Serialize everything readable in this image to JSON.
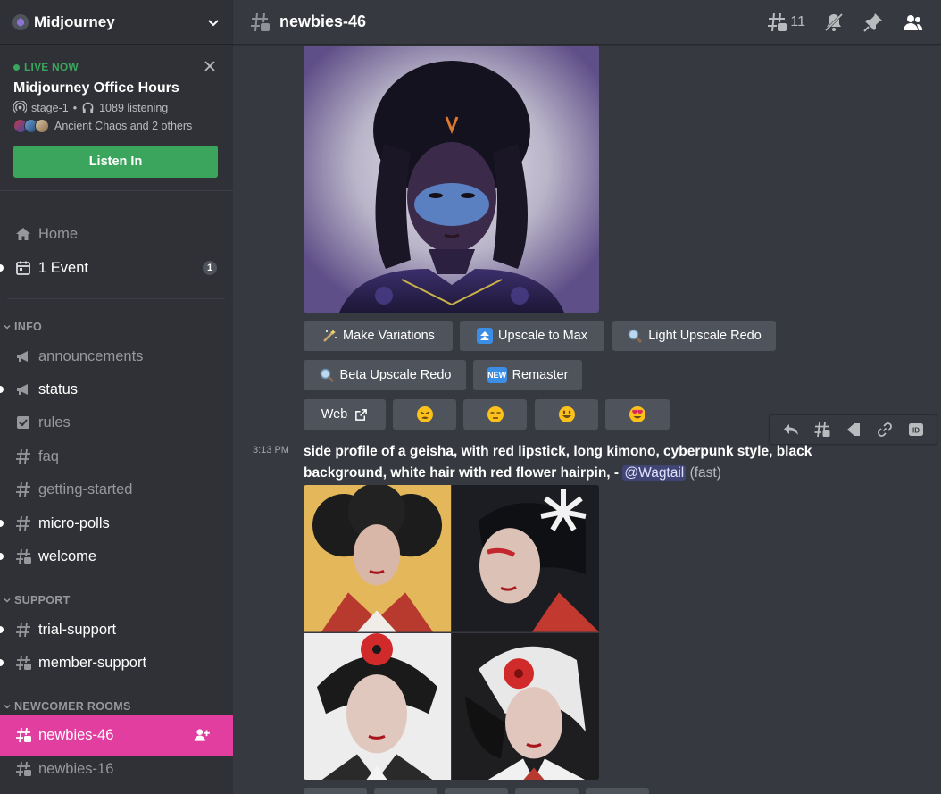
{
  "server": {
    "name": "Midjourney"
  },
  "live": {
    "badge": "LIVE NOW",
    "title": "Midjourney Office Hours",
    "stage": "stage-1",
    "listening": "1089 listening",
    "participants": "Ancient Chaos and 2 others",
    "listen_label": "Listen In"
  },
  "nav": {
    "home": "Home",
    "event_label": "1 Event",
    "event_count": "1"
  },
  "categories": {
    "info": "INFO",
    "support": "SUPPORT",
    "newcomer": "NEWCOMER ROOMS"
  },
  "channels": {
    "announcements": "announcements",
    "status": "status",
    "rules": "rules",
    "faq": "faq",
    "getting_started": "getting-started",
    "micro_polls": "micro-polls",
    "welcome": "welcome",
    "trial_support": "trial-support",
    "member_support": "member-support",
    "newbies_46": "newbies-46",
    "newbies_16": "newbies-16"
  },
  "header": {
    "channel": "newbies-46",
    "thread_count": "11"
  },
  "buttons": {
    "make_variations": "Make Variations",
    "upscale_max": "Upscale to Max",
    "light_upscale": "Light Upscale Redo",
    "beta_upscale": "Beta Upscale Redo",
    "remaster": "Remaster",
    "remaster_badge": "NEW",
    "web": "Web"
  },
  "message": {
    "time": "3:13 PM",
    "prompt": "side profile of a geisha, with red lipstick, long kimono, cyberpunk style, black background, white hair with red flower hairpin, -",
    "mention": "@Wagtail",
    "mode": "(fast)"
  },
  "icons": {
    "thread": "threads-icon",
    "mute": "notification-muted-icon",
    "pin": "pin-icon",
    "members": "member-list-icon"
  },
  "colors": {
    "live_green": "#3ba55d",
    "active_channel": "#e13ea0",
    "blurple": "#5865f2"
  }
}
